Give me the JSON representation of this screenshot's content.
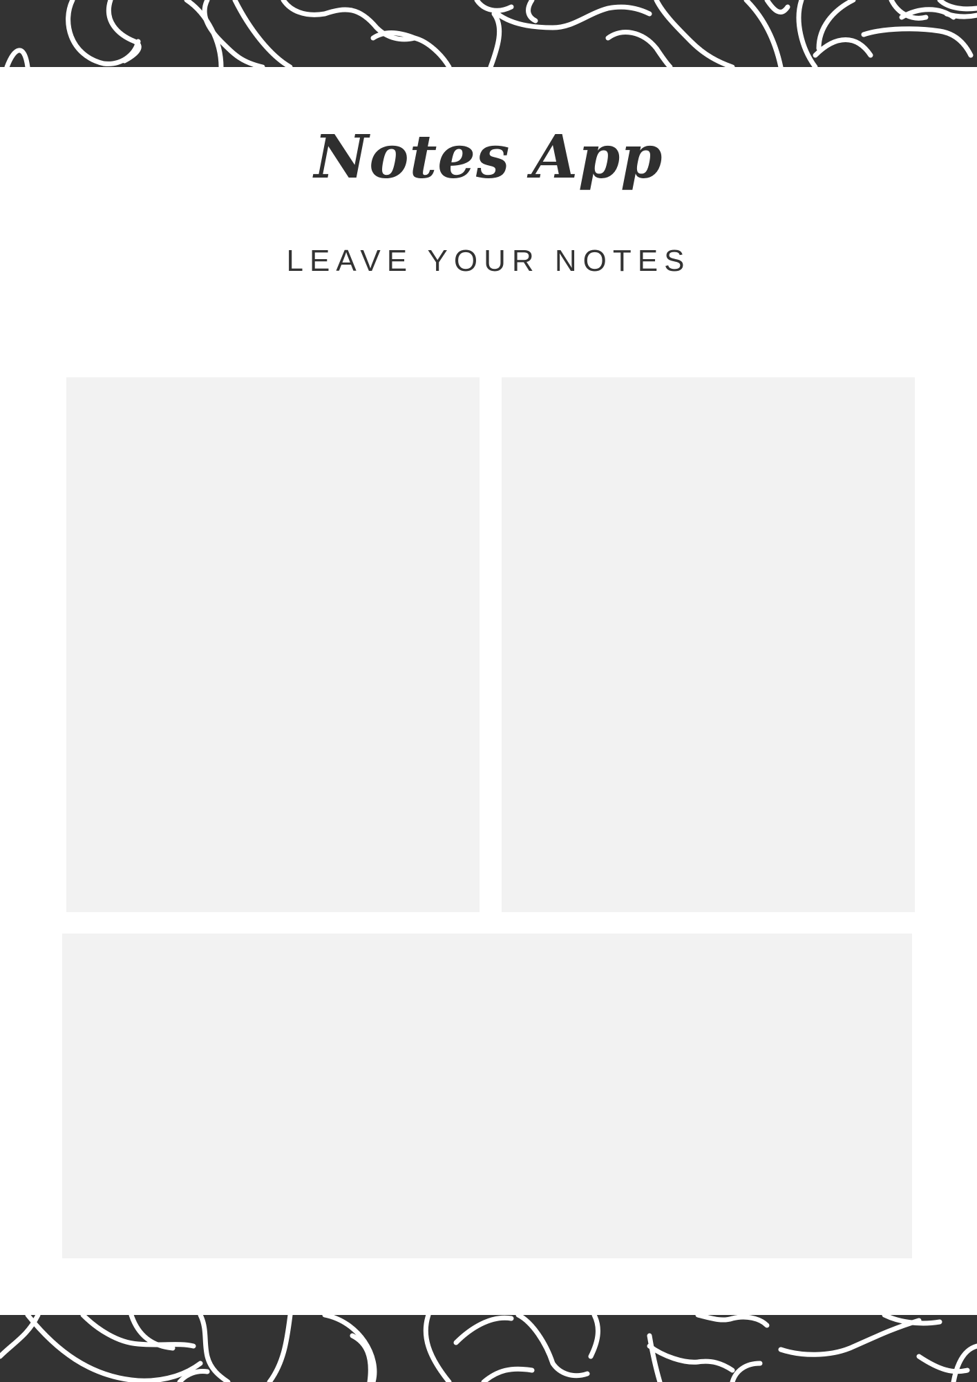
{
  "header": {
    "title": "Notes App",
    "subtitle": "LEAVE YOUR NOTES"
  },
  "notes": [
    {
      "text": ""
    },
    {
      "text": ""
    },
    {
      "text": ""
    }
  ],
  "colors": {
    "band": "#333333",
    "pattern_stroke": "#ffffff",
    "note_background": "#f2f2f2",
    "text": "#333333"
  }
}
